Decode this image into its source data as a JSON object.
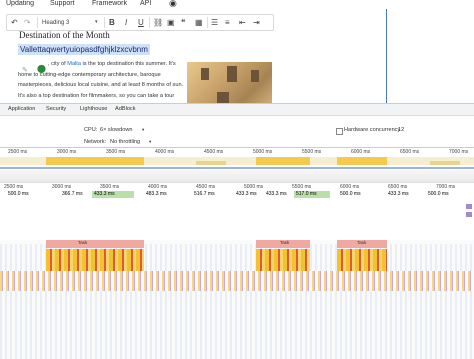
{
  "topnav": {
    "items": [
      "Updating",
      "Support",
      "Framework",
      "API"
    ]
  },
  "toolbar": {
    "undo": "↶",
    "redo": "↷",
    "heading_select": "Heading 3",
    "bold": "B",
    "italic": "I",
    "underline": "U"
  },
  "doc": {
    "heading": "Destination of the Month",
    "selected": "Vallettaqwertyuiopasdfghjklzxcvbnm",
    "para_prefix": ", city of ",
    "link": "Malta",
    "para_rest": " is the top destination this summer. It's home to cutting-edge contemporary architecture, baroque masterpieces, delicious local cuisine, and at least 8 months of sun. It's also a top destination for filmmakers, so you can take a tour through locations familiar to you fro"
  },
  "devtools": {
    "tabs": [
      "Application",
      "Security",
      "Lighthouse",
      "AdBlock"
    ],
    "cpu_label": "CPU:",
    "cpu_value": "6× slowdown",
    "network_label": "Network:",
    "network_value": "No throttling",
    "hw_label": "Hardware concurrency",
    "hw_value": "12"
  },
  "overview_ticks": [
    "2500 ms",
    "3000 ms",
    "3500 ms",
    "4000 ms",
    "4500 ms",
    "5000 ms",
    "5500 ms",
    "6000 ms",
    "6500 ms",
    "7000 ms",
    "7500 ms",
    "8000 ms",
    "8500 ms",
    "9000 ms",
    "9500 ms"
  ],
  "ruler_ticks": [
    "2500 ms",
    "3000 ms",
    "3500 ms",
    "4000 ms",
    "4500 ms",
    "5000 ms",
    "5500 ms",
    "6000 ms",
    "6500 ms",
    "7000 ms"
  ],
  "frames": [
    "500.0 ms",
    "366.7 ms",
    "433.3 ms",
    "483.3 ms",
    "516.7 ms",
    "433.3 ms",
    "433.3 ms",
    "517.0 ms",
    "500.0 ms",
    "433.3 ms",
    "500.0 ms"
  ],
  "task_label": "Task",
  "colors": {
    "accent": "#1a73e8",
    "selection": "#cfe1f7",
    "cpu_band": "#f3c94e",
    "frame_green": "#b8e0a8"
  }
}
